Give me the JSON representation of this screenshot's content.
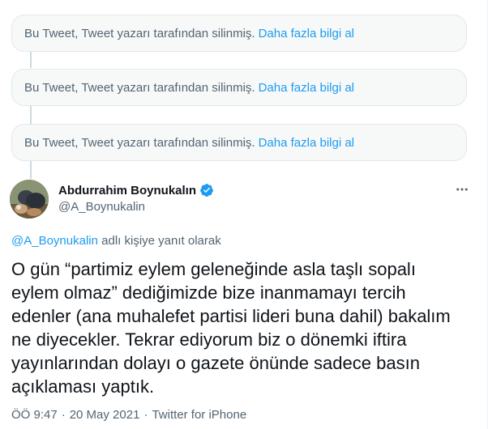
{
  "deleted_tweets": [
    {
      "text": "Bu Tweet, Tweet yazarı tarafından silinmiş.",
      "link": "Daha fazla bilgi al"
    },
    {
      "text": "Bu Tweet, Tweet yazarı tarafından silinmiş.",
      "link": "Daha fazla bilgi al"
    },
    {
      "text": "Bu Tweet, Tweet yazarı tarafından silinmiş.",
      "link": "Daha fazla bilgi al"
    }
  ],
  "tweet": {
    "author_name": "Abdurrahim Boynukalın",
    "handle": "@A_Boynukalin",
    "reply_mention": "@A_Boynukalin",
    "reply_suffix": "adlı kişiye yanıt olarak",
    "text": "O gün “partimiz eylem geleneğinde asla taşlı sopalı\neylem olmaz” dediğimizde bize inanmamayı tercih\nedenler (ana muhalefet partisi lideri buna dahil) bakalım\nne diyecekler. Tekrar ediyorum biz o dönemki iftira\nyayınlarından dolayı o gazete önünde sadece basın\naçıklaması yaptık.",
    "time": "ÖÖ 9:47",
    "date": "20 May 2021",
    "source": "Twitter for iPhone",
    "separator": "·"
  },
  "colors": {
    "accent": "#1d9bf0",
    "muted": "#536471",
    "verified": "#1d9bf0"
  },
  "icons": {
    "verified": "verified-badge-icon",
    "more": "more-horizontal-icon"
  }
}
